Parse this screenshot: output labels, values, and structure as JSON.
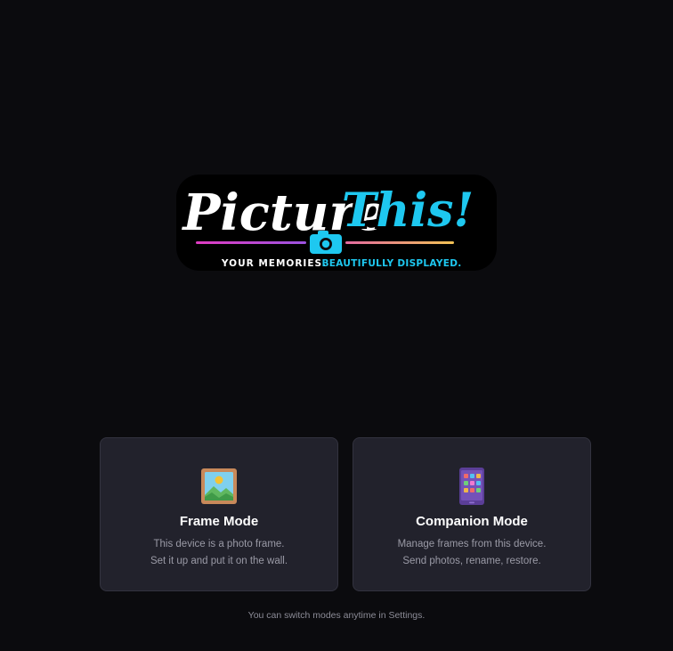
{
  "logo": {
    "word_main": "Picture",
    "word_accent": "This!",
    "tagline_part1": "YOUR MEMORIES.",
    "tagline_part2": "BEAUTIFULLY DISPLAYED.",
    "colors": {
      "accent": "#1ec8f0",
      "magenta": "#d63fbf",
      "gold": "#f0b64a"
    }
  },
  "modes": [
    {
      "icon": "framed-picture-icon",
      "title": "Frame Mode",
      "description_line1": "This device is a photo frame.",
      "description_line2": "Set it up and put it on the wall."
    },
    {
      "icon": "tablet-apps-icon",
      "title": "Companion Mode",
      "description_line1": "Manage frames from this device.",
      "description_line2": "Send photos, rename, restore."
    }
  ],
  "footer": {
    "note": "You can switch modes anytime in Settings."
  },
  "colors": {
    "background": "#0b0b0e",
    "card_background": "#22222c",
    "card_border": "#33333f"
  }
}
